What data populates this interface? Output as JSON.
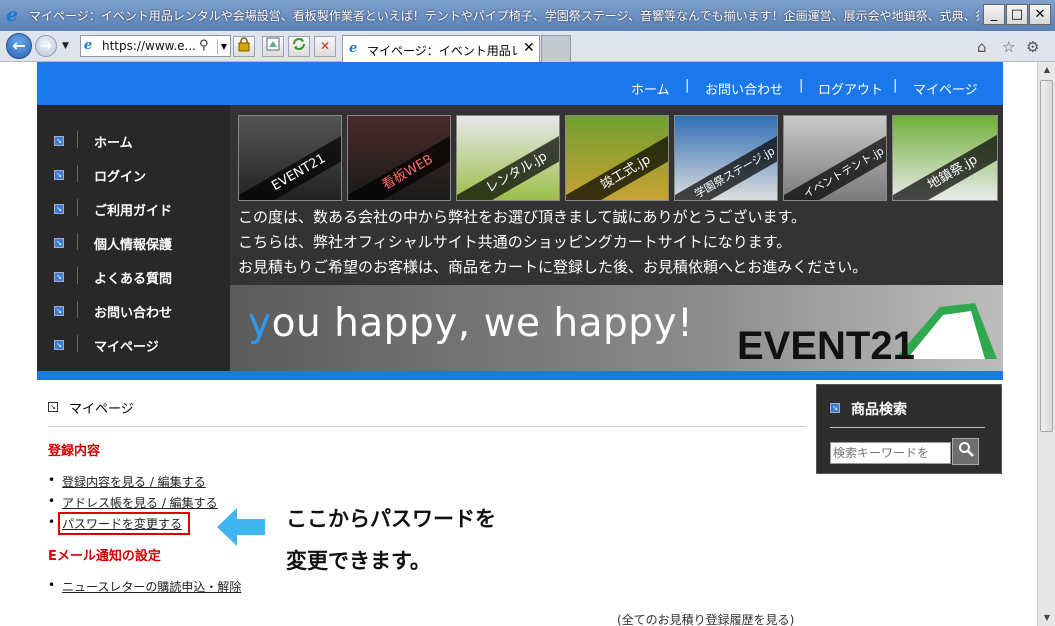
{
  "browser": {
    "title": "マイページ：イベント用品レンタルや会場設営、看板製作業者といえば！テントやパイプ椅子、学園祭ステージ、音響等なんでも揃います！企画運営、展示会や地鎮祭、式典、祭りなどといった多...",
    "address": "https://www.e...",
    "tab_label": "マイページ：イベント用品レ...",
    "tab_close": "✕",
    "minimize": "_",
    "maximize": "□",
    "close": "✕",
    "icons": {
      "back": "back-arrow-icon",
      "forward": "forward-arrow-icon",
      "home": "home-icon",
      "favorites": "star-icon",
      "tools": "gear-icon",
      "search": "search-icon",
      "lock": "lock-icon",
      "compat": "compatibility-icon",
      "refresh": "refresh-icon",
      "stop": "stop-icon"
    }
  },
  "topnav": {
    "items": [
      "ホーム",
      "お問い合わせ",
      "ログアウト",
      "マイページ"
    ],
    "separator": "|"
  },
  "sidenav": {
    "items": [
      "ホーム",
      "ログイン",
      "ご利用ガイド",
      "個人情報保護",
      "よくある質問",
      "お問い合わせ",
      "マイページ"
    ]
  },
  "thumbnails": [
    "EVENT21",
    "看板WEB",
    "レンタル.jp",
    "竣工式.jp",
    "学園祭ステージ.jp",
    "イベントテント.jp",
    "地鎮祭.jp"
  ],
  "hero_text": [
    "この度は、数ある会社の中から弊社をお選び頂きまして誠にありがとうございます。",
    "こちらは、弊社オフィシャルサイト共通のショッピングカートサイトになります。",
    "お見積もりご希望のお客様は、商品をカートに登録した後、お見積依頼へとお進みください。"
  ],
  "banner": {
    "tagline_first": "y",
    "tagline_rest": "ou happy, we happy!",
    "brand": "EVENT21"
  },
  "breadcrumb": "マイページ",
  "sections": {
    "registration": {
      "title": "登録内容",
      "links": [
        "登録内容を見る / 編集する",
        "アドレス帳を見る / 編集する",
        "パスワードを変更する"
      ]
    },
    "email": {
      "title": "Eメール通知の設定",
      "links": [
        "ニュースレターの購読申込・解除"
      ]
    }
  },
  "bullet": "•",
  "callout": [
    "ここからパスワードを",
    "変更できます。"
  ],
  "history_link": "(全てのお見積り登録履歴を見る)",
  "search": {
    "title": "商品検索",
    "placeholder": "検索キーワードを",
    "button_icon": "search-icon"
  },
  "colors": {
    "accent": "#1a78ea",
    "section_title": "#d40000",
    "highlight": "#e30000",
    "callout_arrow": "#3fb6f2"
  }
}
